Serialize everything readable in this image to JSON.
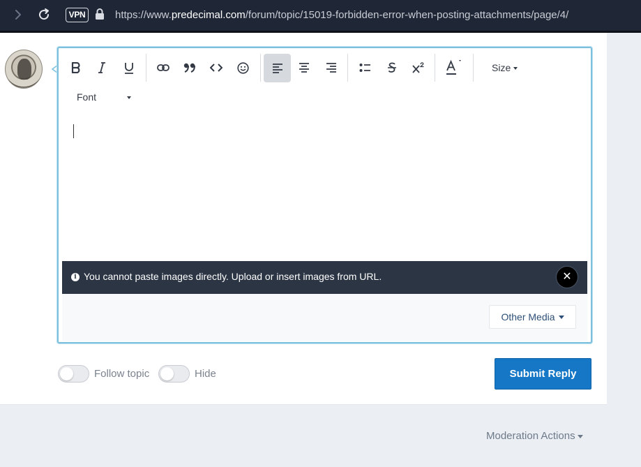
{
  "browser": {
    "vpn_label": "VPN",
    "url_prefix": "https://www.",
    "url_host": "predecimal.com",
    "url_path": "/forum/topic/15019-forbidden-error-when-posting-attachments/page/4/"
  },
  "toolbar": {
    "bold_icon": "bold-icon",
    "size_label": "Size",
    "font_label": "Font"
  },
  "editor": {
    "notice_message": "You cannot paste images directly. Upload or insert images from URL.",
    "close_glyph": "✕",
    "info_glyph": "i",
    "other_media_label": "Other Media"
  },
  "options": {
    "follow_label": "Follow topic",
    "hide_label": "Hide",
    "follow_on": false,
    "hide_on": false
  },
  "actions": {
    "submit_label": "Submit Reply",
    "moderation_label": "Moderation Actions"
  },
  "colors": {
    "accent": "#1577c6",
    "notice_bg": "#2b3544",
    "browser_bg": "#1f2737",
    "editor_border": "#7cc0dd"
  }
}
